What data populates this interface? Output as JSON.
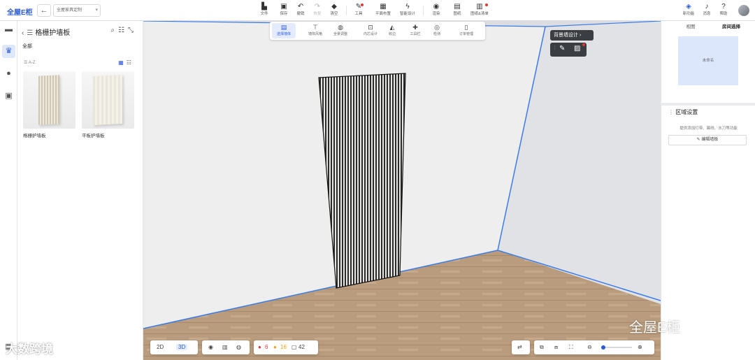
{
  "app": {
    "logo": "全屋E柜",
    "project": "全屋家具定制"
  },
  "toolbar": {
    "file": "文件",
    "save": "保存",
    "undo": "撤销",
    "redo": "恢复",
    "clear": "清空",
    "tools": "工具",
    "floorplan": "平面布置",
    "smart": "智能设计",
    "render": "渲染",
    "drawing": "图纸",
    "list": "图纸&清单",
    "new_feature": "新功能",
    "messages": "消息",
    "help": "帮助"
  },
  "left_panel": {
    "title": "格栅护墙板",
    "filter": "全部",
    "sort": "A-Z",
    "items": [
      {
        "name": "格栅护墙板"
      },
      {
        "name": "平板护墙板"
      }
    ]
  },
  "subtoolbar": {
    "items": [
      "选择墙体",
      "墙体风格",
      "全景调整",
      "内芯设计",
      "收边",
      "工具栏",
      "检测",
      "订单管理"
    ]
  },
  "tooltip": "背景墙设计",
  "right_top": {
    "tabs": [
      "视图",
      "房间选择"
    ],
    "room": "未命名"
  },
  "right_bottom": {
    "title": "区域设置",
    "desc": "提供添加灯带、踢线、水刀等功能",
    "button": "编辑墙板"
  },
  "bottom": {
    "mode_2d": "2D",
    "mode_3d": "3D",
    "errors": "6",
    "warnings": "16",
    "items": "42"
  },
  "watermark": {
    "left": "大数跨境",
    "right": "全屋E柜"
  },
  "colors": {
    "accent": "#2a5ad7",
    "error": "#e53935",
    "warning": "#f59e0b"
  }
}
